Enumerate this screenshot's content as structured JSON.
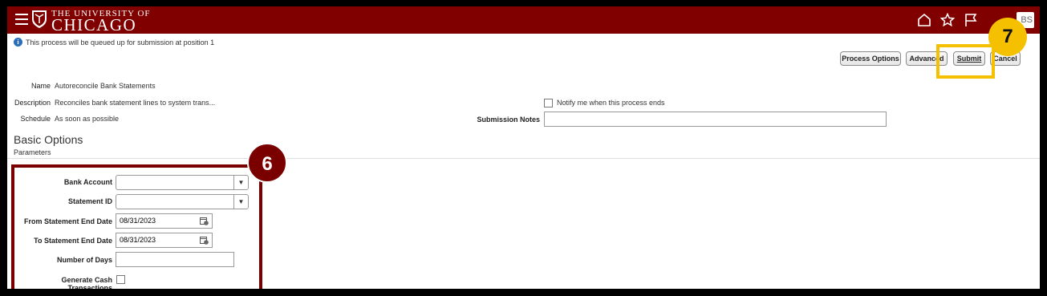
{
  "header": {
    "menu_icon": "hamburger-menu-icon",
    "logo_line1": "THE UNIVERSITY OF",
    "logo_line2": "CHICAGO",
    "brand_color": "#800000",
    "icons": [
      "home-icon",
      "star-icon",
      "flag-icon"
    ],
    "user_initials": "BS"
  },
  "info_message": "This process will be queued up for submission at position 1",
  "actions": {
    "process_options": "Process Options",
    "advanced": "Advanced",
    "submit": "Submit",
    "cancel": "Cancel"
  },
  "details": {
    "name_label": "Name",
    "name_value": "Autoreconcile Bank Statements",
    "description_label": "Description",
    "description_value": "Reconciles bank statement lines to system trans...",
    "schedule_label": "Schedule",
    "schedule_value": "As soon as possible",
    "notify_label": "Notify me when this process ends",
    "notes_label": "Submission Notes",
    "notes_value": ""
  },
  "basic_options": {
    "title": "Basic Options",
    "parameters_label": "Parameters"
  },
  "parameters": {
    "bank_account_label": "Bank Account",
    "bank_account_value": "",
    "statement_id_label": "Statement ID",
    "statement_id_value": "",
    "from_date_label": "From Statement End Date",
    "from_date_value": "08/31/2023",
    "to_date_label": "To Statement End Date",
    "to_date_value": "08/31/2023",
    "days_label": "Number of Days",
    "days_value": "",
    "cash_label": "Generate Cash Transactions"
  },
  "callouts": {
    "step6": "6",
    "step7": "7",
    "step6_color": "#7a0000",
    "step7_color": "#f5c000"
  }
}
